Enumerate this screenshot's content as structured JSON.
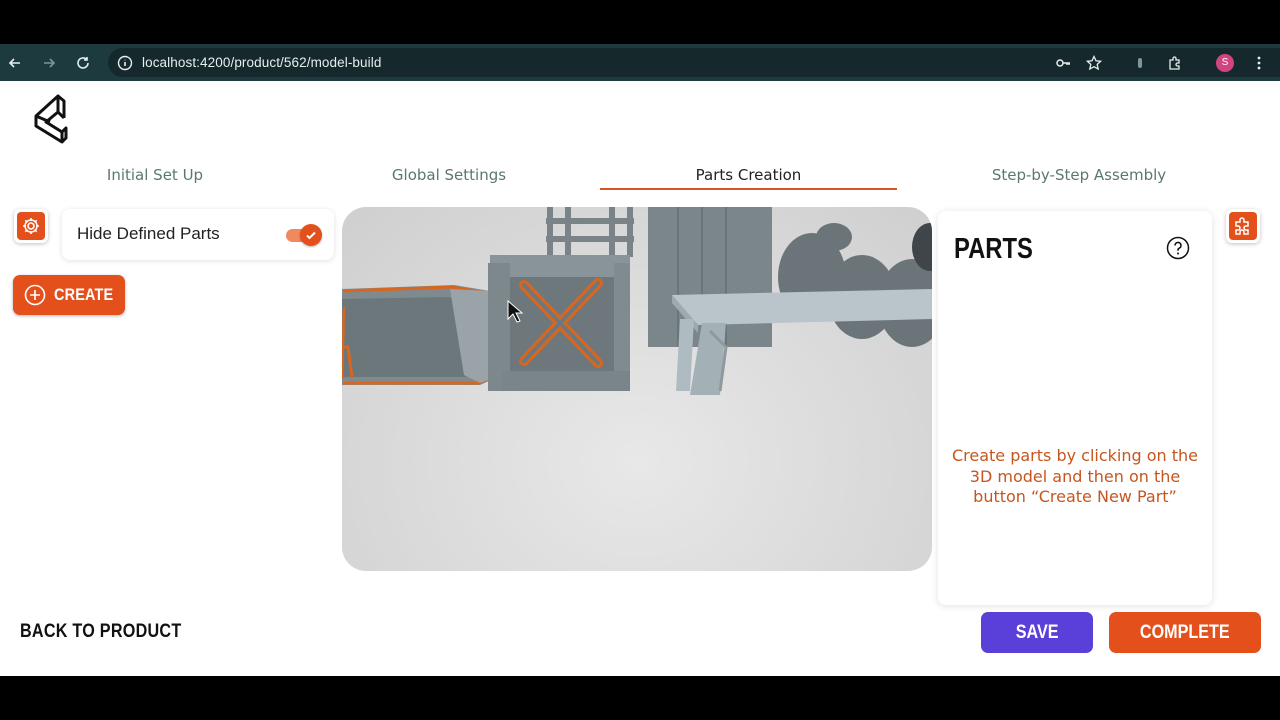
{
  "browser": {
    "url": "localhost:4200/product/562/model-build",
    "avatar_letter": "S",
    "icons": [
      "back-arrow-icon",
      "forward-arrow-icon",
      "reload-icon",
      "site-info-icon",
      "password-key-icon",
      "bookmark-star-icon",
      "extension-icon",
      "puzzle-extensions-icon",
      "kebab-menu-icon"
    ]
  },
  "tabs": [
    {
      "label": "Initial Set Up",
      "active": false
    },
    {
      "label": "Global Settings",
      "active": false
    },
    {
      "label": "Parts Creation",
      "active": true
    },
    {
      "label": "Step-by-Step Assembly",
      "active": false
    }
  ],
  "left_panel": {
    "hide_label": "Hide Defined Parts",
    "hide_on": true,
    "create_label": "CREATE"
  },
  "parts_panel": {
    "title": "PARTS",
    "hint": "Create parts by clicking on the 3D model and then on the button “Create New Part”"
  },
  "footer": {
    "back_label": "BACK TO PRODUCT",
    "save_label": "SAVE",
    "complete_label": "COMPLETE"
  },
  "colors": {
    "accent": "#e4501c",
    "save": "#5b3fd9",
    "hint": "#c6561f",
    "browser_bar": "#1d3b3f"
  }
}
